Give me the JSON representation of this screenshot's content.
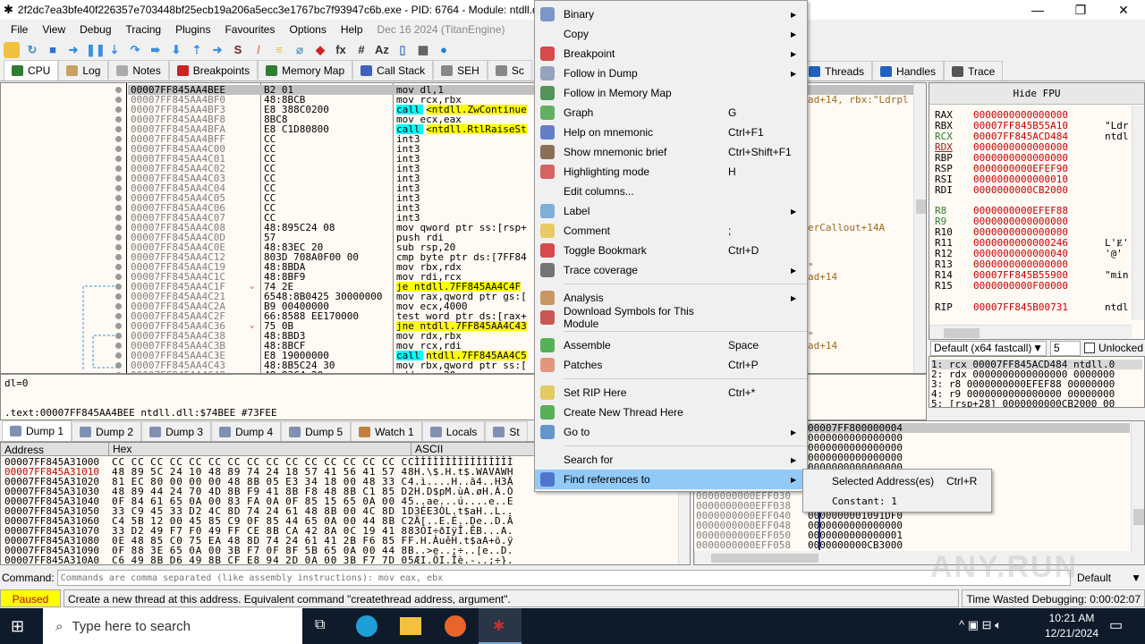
{
  "window": {
    "title": "2f2dc7ea3bfe40f226357e703448bf25ecb19a206a5ecc3e1767bc7f93947c6b.exe - PID: 6764 - Module: ntdll.dll - T",
    "minimize": "—",
    "restore": "❐",
    "close": "✕"
  },
  "menubar": {
    "items": [
      "File",
      "View",
      "Debug",
      "Tracing",
      "Plugins",
      "Favourites",
      "Options",
      "Help"
    ],
    "build": "Dec 16 2024 (TitanEngine)"
  },
  "toolbar": {
    "icons": [
      {
        "name": "open-icon",
        "glyph": "",
        "color": "#f0c040"
      },
      {
        "name": "restart-icon",
        "glyph": "↻",
        "color": "#3a8fd8"
      },
      {
        "name": "stop-icon",
        "glyph": "■",
        "color": "#2f6fd8"
      },
      {
        "name": "run-icon",
        "glyph": "➜",
        "color": "#2f8fe8"
      },
      {
        "name": "pause-icon",
        "glyph": "❚❚",
        "color": "#3b8fe0"
      },
      {
        "name": "step-into-icon",
        "glyph": "⇣",
        "color": "#3b8fe0"
      },
      {
        "name": "step-over-icon",
        "glyph": "↷",
        "color": "#3b8fe0"
      },
      {
        "name": "trace-into-icon",
        "glyph": "➠",
        "color": "#3b8fe0"
      },
      {
        "name": "trace-over-icon",
        "glyph": "⬇",
        "color": "#3b8fe0"
      },
      {
        "name": "execute-till-return-icon",
        "glyph": "⇡",
        "color": "#3b8fe0"
      },
      {
        "name": "run-to-user-code-icon",
        "glyph": "➜",
        "color": "#3b8fe0"
      },
      {
        "name": "scylla-icon",
        "glyph": "S",
        "color": "#7a1f1f"
      },
      {
        "name": "patch-icon",
        "glyph": "/",
        "color": "#e08060"
      },
      {
        "name": "comments-icon",
        "glyph": "≡",
        "color": "#e8c040"
      },
      {
        "name": "labels-icon",
        "glyph": "⌀",
        "color": "#60a0d0"
      },
      {
        "name": "bookmarks-icon",
        "glyph": "◆",
        "color": "#d02020"
      },
      {
        "name": "functions-icon",
        "glyph": "fx",
        "color": "#333"
      },
      {
        "name": "hash-icon",
        "glyph": "#",
        "color": "#333"
      },
      {
        "name": "font-icon",
        "glyph": "Az",
        "color": "#333"
      },
      {
        "name": "device-icon",
        "glyph": "▯",
        "color": "#4080c0"
      },
      {
        "name": "calculator-icon",
        "glyph": "▦",
        "color": "#555"
      },
      {
        "name": "globe-icon",
        "glyph": "●",
        "color": "#2080d0"
      }
    ]
  },
  "tabs": {
    "left": [
      {
        "label": "CPU",
        "color": "#2e7d32"
      },
      {
        "label": "Log",
        "color": "#c8a060"
      },
      {
        "label": "Notes",
        "color": "#aaa"
      },
      {
        "label": "Breakpoints",
        "color": "#d02020"
      },
      {
        "label": "Memory Map",
        "color": "#2e7d32"
      },
      {
        "label": "Call Stack",
        "color": "#4060c0"
      },
      {
        "label": "SEH",
        "color": "#888"
      },
      {
        "label": "Sc",
        "color": "#888"
      }
    ],
    "right": [
      {
        "label": "Threads",
        "color": "#2060c0"
      },
      {
        "label": "Handles",
        "color": "#2060c0"
      },
      {
        "label": "Trace",
        "color": "#555"
      }
    ]
  },
  "disasm": {
    "rows": [
      {
        "addr": "00007FF845AA4BEE",
        "bytes": "B2 01",
        "instr": "mov dl,1",
        "hl": "",
        "comment": ""
      },
      {
        "addr": "00007FF845AA4BF0",
        "bytes": "48:8BCB",
        "instr": "mov rcx,rbx",
        "hl": "",
        "comment": "ad+14, rbx:\"Ldrpl"
      },
      {
        "addr": "00007FF845AA4BF3",
        "bytes": "E8 388C0200",
        "instr": "call <ntdll.ZwContinue",
        "hl": "call",
        "comment": ""
      },
      {
        "addr": "00007FF845AA4BF8",
        "bytes": "8BC8",
        "instr": "mov ecx,eax",
        "hl": "",
        "comment": ""
      },
      {
        "addr": "00007FF845AA4BFA",
        "bytes": "E8 C1D80800",
        "instr": "call <ntdll.RtlRaiseSt",
        "hl": "call",
        "comment": ""
      },
      {
        "addr": "00007FF845AA4BFF",
        "bytes": "CC",
        "instr": "int3",
        "hl": "",
        "comment": ""
      },
      {
        "addr": "00007FF845AA4C00",
        "bytes": "CC",
        "instr": "int3",
        "hl": "",
        "comment": ""
      },
      {
        "addr": "00007FF845AA4C01",
        "bytes": "CC",
        "instr": "int3",
        "hl": "",
        "comment": ""
      },
      {
        "addr": "00007FF845AA4C02",
        "bytes": "CC",
        "instr": "int3",
        "hl": "",
        "comment": ""
      },
      {
        "addr": "00007FF845AA4C03",
        "bytes": "CC",
        "instr": "int3",
        "hl": "",
        "comment": ""
      },
      {
        "addr": "00007FF845AA4C04",
        "bytes": "CC",
        "instr": "int3",
        "hl": "",
        "comment": ""
      },
      {
        "addr": "00007FF845AA4C05",
        "bytes": "CC",
        "instr": "int3",
        "hl": "",
        "comment": ""
      },
      {
        "addr": "00007FF845AA4C06",
        "bytes": "CC",
        "instr": "int3",
        "hl": "",
        "comment": ""
      },
      {
        "addr": "00007FF845AA4C07",
        "bytes": "CC",
        "instr": "int3",
        "hl": "",
        "comment": ""
      },
      {
        "addr": "00007FF845AA4C08",
        "bytes": "48:895C24 08",
        "instr": "mov qword ptr ss:[rsp+",
        "hl": "",
        "comment": "erCallout+14A"
      },
      {
        "addr": "00007FF845AA4C0D",
        "bytes": "57",
        "instr": "push rdi",
        "hl": "",
        "comment": ""
      },
      {
        "addr": "00007FF845AA4C0E",
        "bytes": "48:83EC 20",
        "instr": "sub rsp,20",
        "hl": "",
        "comment": ""
      },
      {
        "addr": "00007FF845AA4C12",
        "bytes": "803D 708A0F00 00",
        "instr": "cmp byte ptr ds:[7FF84",
        "hl": "",
        "comment": ""
      },
      {
        "addr": "00007FF845AA4C19",
        "bytes": "48:8BDA",
        "instr": "mov rbx,rdx",
        "hl": "",
        "comment": "\""
      },
      {
        "addr": "00007FF845AA4C1C",
        "bytes": "48:8BF9",
        "instr": "mov rdi,rcx",
        "hl": "",
        "comment": "ad+14"
      },
      {
        "addr": "00007FF845AA4C1F",
        "bytes": "74 2E",
        "instr": "je ntdll.7FF845AA4C4F",
        "hl": "jmp",
        "comment": ""
      },
      {
        "addr": "00007FF845AA4C21",
        "bytes": "6548:8B0425 30000000",
        "instr": "mov rax,qword ptr gs:[",
        "hl": "",
        "comment": ""
      },
      {
        "addr": "00007FF845AA4C2A",
        "bytes": "B9 00400000",
        "instr": "mov ecx,4000",
        "hl": "",
        "comment": ""
      },
      {
        "addr": "00007FF845AA4C2F",
        "bytes": "66:8588 EE170000",
        "instr": "test word ptr ds:[rax+",
        "hl": "",
        "comment": ""
      },
      {
        "addr": "00007FF845AA4C36",
        "bytes": "75 0B",
        "instr": "jne ntdll.7FF845AA4C43",
        "hl": "jmp",
        "comment": ""
      },
      {
        "addr": "00007FF845AA4C38",
        "bytes": "48:8BD3",
        "instr": "mov rdx,rbx",
        "hl": "",
        "comment": "\""
      },
      {
        "addr": "00007FF845AA4C3B",
        "bytes": "48:8BCF",
        "instr": "mov rcx,rdi",
        "hl": "",
        "comment": "ad+14"
      },
      {
        "addr": "00007FF845AA4C3E",
        "bytes": "E8 19000000",
        "instr": "call ntdll.7FF845AA4C5",
        "hl": "call",
        "comment": ""
      },
      {
        "addr": "00007FF845AA4C43",
        "bytes": "48:8B5C24 30",
        "instr": "mov rbx,qword ptr ss:[",
        "hl": "",
        "comment": ""
      },
      {
        "addr": "00007FF845AA4C48",
        "bytes": "48:83C4 20",
        "instr": "add rsp,20",
        "hl": "",
        "comment": ""
      }
    ]
  },
  "registers": {
    "hide_fpu": "Hide FPU",
    "rows": [
      {
        "name": "RAX",
        "value": "0000000000000000",
        "info": ""
      },
      {
        "name": "RBX",
        "value": "00007FF845B55A10",
        "info": "\"Ldr"
      },
      {
        "name": "RCX",
        "value": "00007FF845ACD484",
        "info": "ntdl"
      },
      {
        "name": "RDX",
        "value": "0000000000000000",
        "info": ""
      },
      {
        "name": "RBP",
        "value": "0000000000000000",
        "info": ""
      },
      {
        "name": "RSP",
        "value": "0000000000EFEF90",
        "info": ""
      },
      {
        "name": "RSI",
        "value": "0000000000000010",
        "info": ""
      },
      {
        "name": "RDI",
        "value": "0000000000CB2000",
        "info": ""
      },
      {
        "name": "R8",
        "value": "0000000000EFEF88",
        "info": ""
      },
      {
        "name": "R9",
        "value": "0000000000000000",
        "info": ""
      },
      {
        "name": "R10",
        "value": "0000000000000000",
        "info": ""
      },
      {
        "name": "R11",
        "value": "0000000000000246",
        "info": "L'Ɇ'"
      },
      {
        "name": "R12",
        "value": "0000000000000040",
        "info": "'@'"
      },
      {
        "name": "R13",
        "value": "0000000000000000",
        "info": ""
      },
      {
        "name": "R14",
        "value": "00007FF845B55900",
        "info": "\"min"
      },
      {
        "name": "R15",
        "value": "0000000000F00000",
        "info": ""
      },
      {
        "name": "RIP",
        "value": "00007FF845B00731",
        "info": "ntdl"
      }
    ],
    "callconv": "Default (x64 fastcall)",
    "argcount": "5",
    "unlocked": "Unlocked",
    "args": [
      "1: rcx 00007FF845ACD484 ntdll.0",
      "2: rdx 0000000000000000 0000000",
      "3: r8 0000000000EFEF88 00000000",
      "4: r9 0000000000000000 00000000",
      "5: [rsp+28] 0000000000CB2000 00"
    ]
  },
  "info": {
    "line1": "dl=0",
    "line2": ".text:00007FF845AA4BEE ntdll.dll:$74BEE #73FEE"
  },
  "dump_tabs": [
    "Dump 1",
    "Dump 2",
    "Dump 3",
    "Dump 4",
    "Dump 5",
    "Watch 1",
    "Locals",
    "St"
  ],
  "dump": {
    "headers": [
      "Address",
      "Hex",
      "ASCII"
    ],
    "rows": [
      {
        "addr": "00007FF845A31000",
        "hex": "CC CC CC CC CC CC CC CC CC CC CC CC CC CC CC CC",
        "ascii": "ÌÌÌÌÌÌÌÌÌÌÌÌÌÌÌÌ"
      },
      {
        "addr": "00007FF845A31010",
        "hex": "48 89 5C 24 10 48 89 74 24 18 57 41 56 41 57 48",
        "ascii": "H.\\$.H.t$.WAVAWH"
      },
      {
        "addr": "00007FF845A31020",
        "hex": "81 EC 80 00 00 00 48 8B 05 E3 34 18 00 48 33 C4",
        "ascii": ".ì....H..ã4..H3Ä"
      },
      {
        "addr": "00007FF845A31030",
        "hex": "48 89 44 24 70 4D 8B F9 41 8B F8 48 8B C1 85 D2",
        "ascii": "H.D$pM.ùA.øH.Á.Ò"
      },
      {
        "addr": "00007FF845A31040",
        "hex": "0F 84 61 65 0A 00 83 FA 0A 0F 85 15 65 0A 00 45",
        "ascii": "..ae...ú....e..E"
      },
      {
        "addr": "00007FF845A31050",
        "hex": "33 C9 45 33 D2 4C 8D 74 24 61 48 8B 00 4C 8D 1D",
        "ascii": "3ÉE3ÒL.t$aH..L.."
      },
      {
        "addr": "00007FF845A31060",
        "hex": "C4 5B 12 00 45 85 C9 0F 85 44 65 0A 00 44 8B C2",
        "ascii": "Ä[..E.É..De..D.Â"
      },
      {
        "addr": "00007FF845A31070",
        "hex": "33 D2 49 F7 F0 49 FF CE 8B CA 42 8A 0C 19 41 88",
        "ascii": "3ÒI÷ðIÿÎ.ÊB...A."
      },
      {
        "addr": "00007FF845A31080",
        "hex": "0E 48 85 C0 75 EA 48 8D 74 24 61 41 2B F6 85 FF",
        "ascii": ".H.ÀuêH.t$aA+ö.ÿ"
      },
      {
        "addr": "00007FF845A31090",
        "hex": "0F 88 3E 65 0A 00 3B F7 0F 8F 5B 65 0A 00 44 8B",
        "ascii": "..>e..;÷..[e..D."
      },
      {
        "addr": "00007FF845A310A0",
        "hex": "C6 49 8B D6 49 8B CF E8 94 2D 0A 00 3B F7 7D 05",
        "ascii": "ÆI.ÖI.Ïè.-..;÷}."
      }
    ]
  },
  "stack": {
    "top_values": [
      "00007FF800000004",
      "0000000000000000",
      "0000000000000000",
      "0000000000000000",
      "0000000000000000"
    ],
    "rows": [
      {
        "addr": "0000000000EFF030",
        "value": ""
      },
      {
        "addr": "0000000000EFF038",
        "value": ""
      },
      {
        "addr": "0000000000EFF040",
        "value": "0000000001091DF0"
      },
      {
        "addr": "0000000000EFF048",
        "value": "0000000000000000"
      },
      {
        "addr": "0000000000EFF050",
        "value": "0000000000000001"
      },
      {
        "addr": "0000000000EFF058",
        "value": "0000000000CB3000"
      }
    ]
  },
  "context_menu": {
    "items": [
      {
        "label": "Binary",
        "shortcut": "",
        "sub": true,
        "icon": "binary-icon",
        "color": "#6080c0"
      },
      {
        "label": "Copy",
        "shortcut": "",
        "sub": true,
        "icon": "copy-icon",
        "color": ""
      },
      {
        "label": "Breakpoint",
        "shortcut": "",
        "sub": true,
        "icon": "breakpoint-icon",
        "color": "#d02020"
      },
      {
        "label": "Follow in Dump",
        "shortcut": "",
        "sub": true,
        "icon": "dump-icon",
        "color": "#8090b0"
      },
      {
        "label": "Follow in Memory Map",
        "shortcut": "",
        "sub": false,
        "icon": "memory-map-icon",
        "color": "#2e7d32"
      },
      {
        "label": "Graph",
        "shortcut": "G",
        "sub": false,
        "icon": "graph-icon",
        "color": "#40a040"
      },
      {
        "label": "Help on mnemonic",
        "shortcut": "Ctrl+F1",
        "sub": false,
        "icon": "help-icon",
        "color": "#4060c0"
      },
      {
        "label": "Show mnemonic brief",
        "shortcut": "Ctrl+Shift+F1",
        "sub": false,
        "icon": "brief-icon",
        "color": "#705030"
      },
      {
        "label": "Highlighting mode",
        "shortcut": "H",
        "sub": false,
        "icon": "highlight-icon",
        "color": "#d04040"
      },
      {
        "label": "Edit columns...",
        "shortcut": "",
        "sub": false,
        "icon": "",
        "color": ""
      },
      {
        "label": "Label",
        "shortcut": "",
        "sub": true,
        "icon": "label-icon",
        "color": "#60a0d0"
      },
      {
        "label": "Comment",
        "shortcut": ";",
        "sub": false,
        "icon": "comment-icon",
        "color": "#e8c040"
      },
      {
        "label": "Toggle Bookmark",
        "shortcut": "Ctrl+D",
        "sub": false,
        "icon": "bookmark-icon",
        "color": "#d02020"
      },
      {
        "label": "Trace coverage",
        "shortcut": "",
        "sub": true,
        "icon": "trace-icon",
        "color": "#555"
      },
      {
        "sep": true
      },
      {
        "label": "Analysis",
        "shortcut": "",
        "sub": true,
        "icon": "analysis-icon",
        "color": "#c08040"
      },
      {
        "label": "Download Symbols for This Module",
        "shortcut": "",
        "sub": false,
        "icon": "download-icon",
        "color": "#c03030"
      },
      {
        "sep": true
      },
      {
        "label": "Assemble",
        "shortcut": "Space",
        "sub": false,
        "icon": "assemble-icon",
        "color": "#30a030"
      },
      {
        "label": "Patches",
        "shortcut": "Ctrl+P",
        "sub": false,
        "icon": "patch-icon",
        "color": "#e08060"
      },
      {
        "sep": true
      },
      {
        "label": "Set RIP Here",
        "shortcut": "Ctrl+*",
        "sub": false,
        "icon": "rip-icon",
        "color": "#e0c040"
      },
      {
        "label": "Create New Thread Here",
        "shortcut": "",
        "sub": false,
        "icon": "thread-icon",
        "color": "#30a030"
      },
      {
        "label": "Go to",
        "shortcut": "",
        "sub": true,
        "icon": "goto-icon",
        "color": "#4080c0"
      },
      {
        "sep": true
      },
      {
        "label": "Search for",
        "shortcut": "",
        "sub": true,
        "icon": "",
        "color": ""
      },
      {
        "label": "Find references to",
        "shortcut": "",
        "sub": true,
        "icon": "references-icon",
        "color": "#4060c0",
        "active": true
      }
    ],
    "submenu": [
      {
        "label": "Selected Address(es)",
        "shortcut": "Ctrl+R"
      },
      {
        "label": "Constant: 1",
        "shortcut": ""
      }
    ]
  },
  "command": {
    "label": "Command:",
    "placeholder": "Commands are comma separated (like assembly instructions): mov eax, ebx",
    "mode": "Default"
  },
  "status": {
    "state": "Paused",
    "message": "Create a new thread at this address. Equivalent command \"createthread address, argument\".",
    "time": "Time Wasted Debugging: 0:00:02:07"
  },
  "taskbar": {
    "search": "Type here to search",
    "time": "10:21 AM",
    "date": "12/21/2024"
  },
  "watermark": "ANY.RUN"
}
